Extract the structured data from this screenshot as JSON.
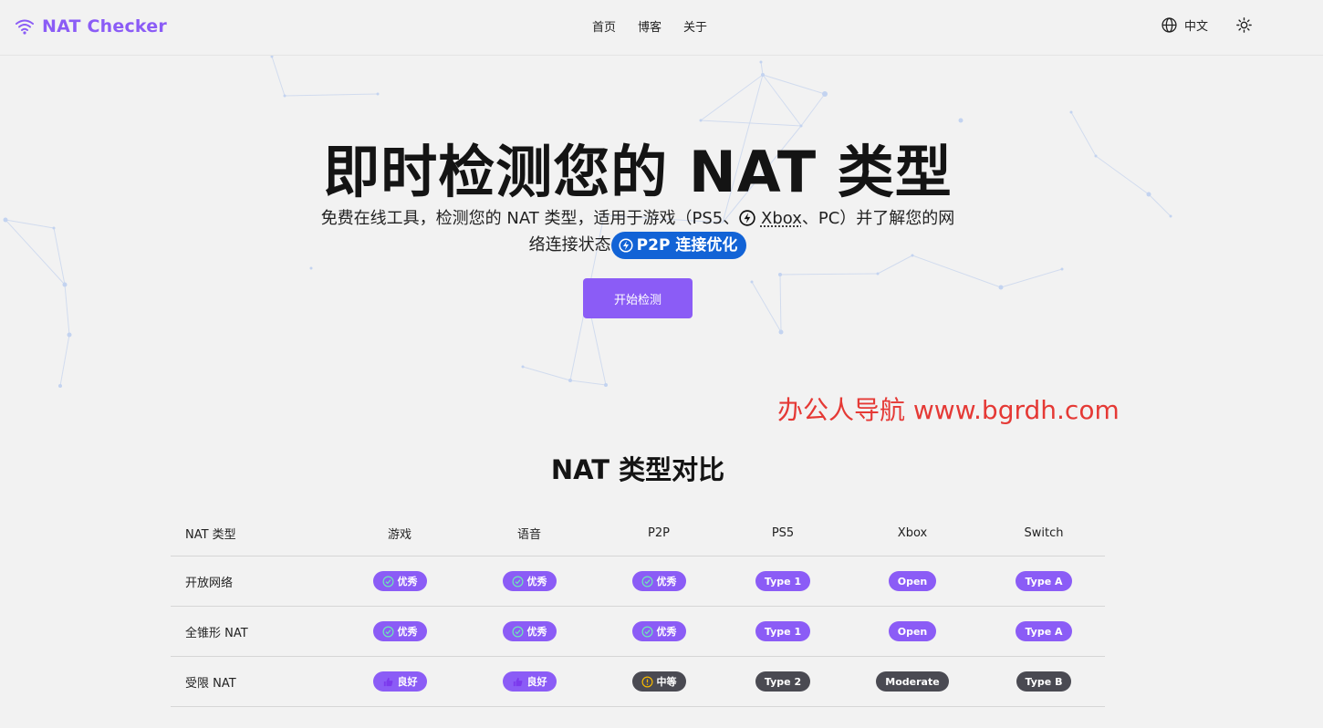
{
  "header": {
    "brand": "NAT Checker",
    "nav": [
      "首页",
      "博客",
      "关于"
    ],
    "language": "中文"
  },
  "hero": {
    "title": "即时检测您的 NAT 类型",
    "subtitle_before_xbox": "免费在线工具，检测您的 NAT 类型，适用于游戏（PS5、",
    "xbox_word": "Xbox",
    "subtitle_after_xbox": "、PC）并了解您的网络连接状态",
    "badge": "P2P 连接优化",
    "start_button": "开始检测"
  },
  "watermark": "办公人导航 www.bgrdh.com",
  "comparison": {
    "title": "NAT 类型对比",
    "headers": [
      "NAT 类型",
      "游戏",
      "语音",
      "P2P",
      "PS5",
      "Xbox",
      "Switch"
    ],
    "rows": [
      {
        "name": "开放网络",
        "game": "优秀",
        "voice": "优秀",
        "p2p": "优秀",
        "ps5": "Type 1",
        "xbox": "Open",
        "switch": "Type A"
      },
      {
        "name": "全锥形 NAT",
        "game": "优秀",
        "voice": "优秀",
        "p2p": "优秀",
        "ps5": "Type 1",
        "xbox": "Open",
        "switch": "Type A"
      },
      {
        "name": "受限 NAT",
        "game": "良好",
        "voice": "良好",
        "p2p": "中等",
        "ps5": "Type 2",
        "xbox": "Moderate",
        "switch": "Type B"
      }
    ]
  },
  "colors": {
    "accent": "#8b5cf6",
    "badge_blue": "#1263d6",
    "pill_dark": "#4a4a52",
    "watermark_red": "#e53935"
  }
}
